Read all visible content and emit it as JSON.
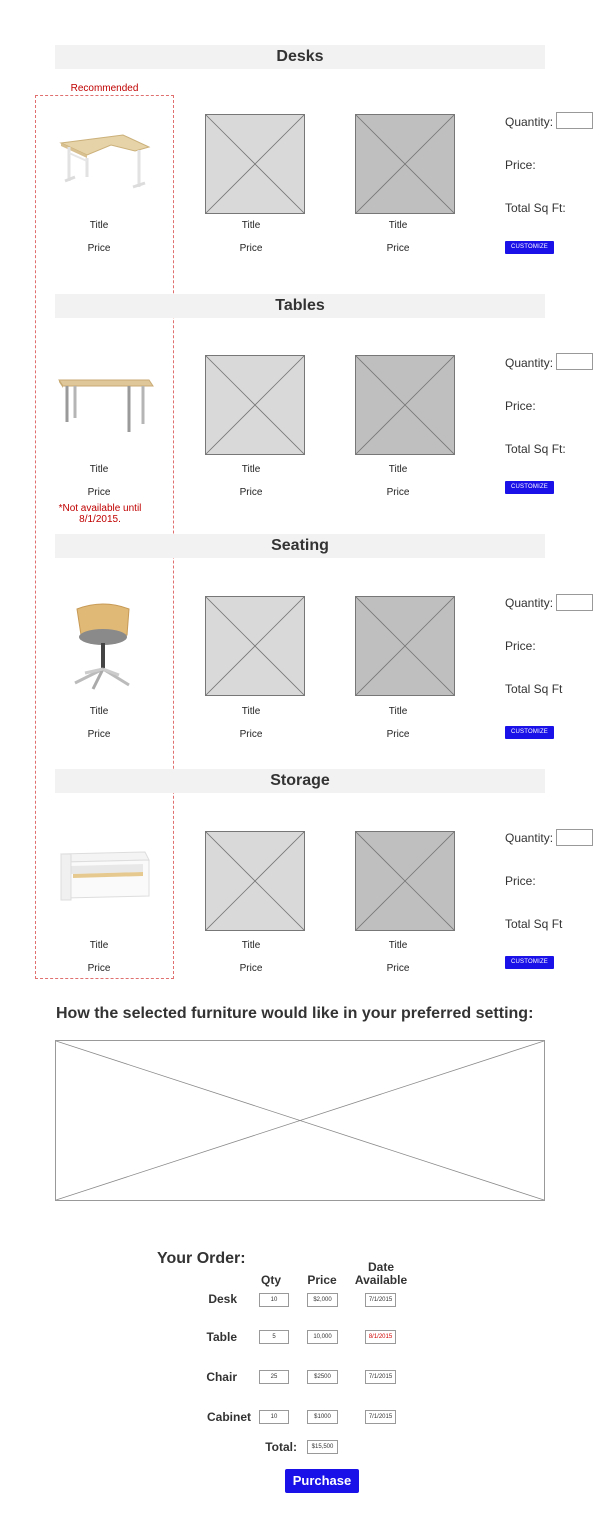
{
  "recommended_label": "Recommended",
  "sections": [
    {
      "title": "Desks",
      "quantity_label": "Quantity:",
      "price_label": "Price:",
      "sqft_label": "Total Sq Ft:",
      "customize_label": "CUSTOMIZE",
      "items": [
        {
          "title": "Title",
          "price": "Price"
        },
        {
          "title": "Title",
          "price": "Price"
        },
        {
          "title": "Title",
          "price": "Price"
        }
      ]
    },
    {
      "title": "Tables",
      "quantity_label": "Quantity:",
      "price_label": "Price:",
      "sqft_label": "Total Sq Ft:",
      "customize_label": "CUSTOMIZE",
      "note": "*Not available until 8/1/2015.",
      "items": [
        {
          "title": "Title",
          "price": "Price"
        },
        {
          "title": "Title",
          "price": "Price"
        },
        {
          "title": "Title",
          "price": "Price"
        }
      ]
    },
    {
      "title": "Seating",
      "quantity_label": "Quantity:",
      "price_label": "Price:",
      "sqft_label": "Total Sq Ft",
      "customize_label": "CUSTOMIZE",
      "items": [
        {
          "title": "Title",
          "price": "Price"
        },
        {
          "title": "Title",
          "price": "Price"
        },
        {
          "title": "Title",
          "price": "Price"
        }
      ]
    },
    {
      "title": "Storage",
      "quantity_label": "Quantity:",
      "price_label": "Price:",
      "sqft_label": "Total Sq Ft",
      "customize_label": "CUSTOMIZE",
      "items": [
        {
          "title": "Title",
          "price": "Price"
        },
        {
          "title": "Title",
          "price": "Price"
        },
        {
          "title": "Title",
          "price": "Price"
        }
      ]
    }
  ],
  "preview_heading": "How the selected furniture would like in your preferred setting:",
  "order": {
    "title": "Your Order:",
    "headers": {
      "qty": "Qty",
      "price": "Price",
      "date_line1": "Date",
      "date_line2": "Available"
    },
    "rows": [
      {
        "label": "Desk",
        "qty": "10",
        "price": "$2,000",
        "date": "7/1/2015",
        "date_unavailable": false
      },
      {
        "label": "Table",
        "qty": "5",
        "price": "10,000",
        "date": "8/1/2015",
        "date_unavailable": true
      },
      {
        "label": "Chair",
        "qty": "25",
        "price": "$2500",
        "date": "7/1/2015",
        "date_unavailable": false
      },
      {
        "label": "Cabinet",
        "qty": "10",
        "price": "$1000",
        "date": "7/1/2015",
        "date_unavailable": false
      }
    ],
    "total_label": "Total:",
    "total_value": "$15,500",
    "purchase_label": "Purchase"
  },
  "colors": {
    "accent": "#1a10e8",
    "warning": "#c00000",
    "section_bar": "#f2f2f2"
  }
}
